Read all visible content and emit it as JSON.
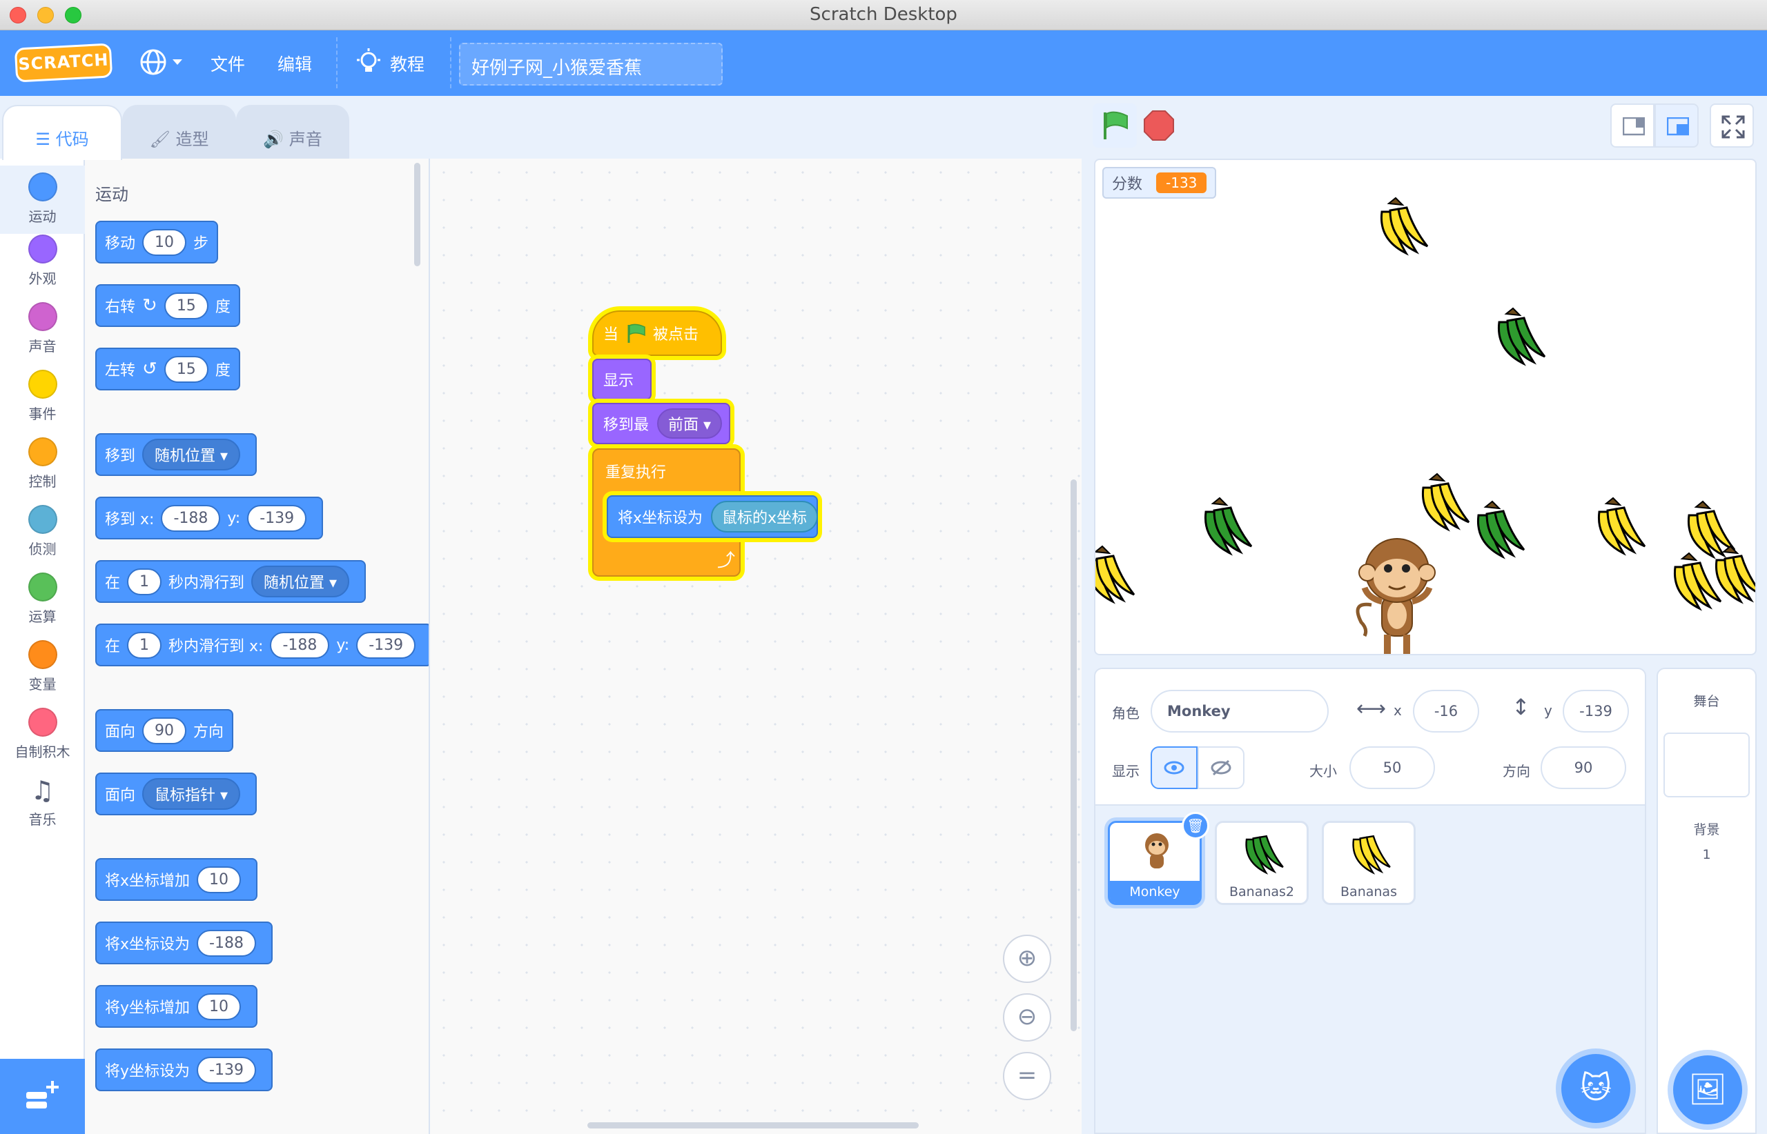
{
  "window": {
    "title": "Scratch Desktop"
  },
  "menubar": {
    "logo": "SCRATCH",
    "file": "文件",
    "edit": "编辑",
    "tutorials": "教程",
    "project_title": "好例子网_小猴爱香蕉"
  },
  "tabs": [
    {
      "label": "代码",
      "icon": "code-icon",
      "active": true
    },
    {
      "label": "造型",
      "icon": "brush-icon",
      "active": false
    },
    {
      "label": "声音",
      "icon": "speaker-icon",
      "active": false
    }
  ],
  "categories": [
    {
      "label": "运动",
      "color": "#4c97ff"
    },
    {
      "label": "外观",
      "color": "#9966ff"
    },
    {
      "label": "声音",
      "color": "#cf63cf"
    },
    {
      "label": "事件",
      "color": "#ffd500"
    },
    {
      "label": "控制",
      "color": "#ffab19"
    },
    {
      "label": "侦测",
      "color": "#5cb1d6"
    },
    {
      "label": "运算",
      "color": "#59c059"
    },
    {
      "label": "变量",
      "color": "#ff8c1a"
    },
    {
      "label": "自制积木",
      "color": "#ff6680"
    },
    {
      "label": "音乐",
      "color": "#0fbd8c"
    }
  ],
  "palette": {
    "heading": "运动",
    "blocks": {
      "move_a": "移动",
      "move_val": "10",
      "move_b": "步",
      "turn_right_a": "右转",
      "turn_right_val": "15",
      "turn_right_b": "度",
      "turn_left_a": "左转",
      "turn_left_val": "15",
      "turn_left_b": "度",
      "goto_a": "移到",
      "goto_drop": "随机位置",
      "gotoxy_a": "移到 x:",
      "gotoxy_x": "-188",
      "gotoxy_b": "y:",
      "gotoxy_y": "-139",
      "glide_a": "在",
      "glide_secs": "1",
      "glide_b": "秒内滑行到",
      "glide_drop": "随机位置",
      "glidexy_a": "在",
      "glidexy_secs": "1",
      "glidexy_b": "秒内滑行到 x:",
      "glidexy_x": "-188",
      "glidexy_c": "y:",
      "glidexy_y": "-139",
      "point_a": "面向",
      "point_val": "90",
      "point_b": "方向",
      "pointto_a": "面向",
      "pointto_drop": "鼠标指针",
      "changex_a": "将x坐标增加",
      "changex_val": "10",
      "setx_a": "将x坐标设为",
      "setx_val": "-188",
      "changey_a": "将y坐标增加",
      "changey_val": "10",
      "sety_a": "将y坐标设为",
      "sety_val": "-139"
    }
  },
  "script": {
    "hat_a": "当",
    "hat_b": "被点击",
    "show": "显示",
    "front_a": "移到最",
    "front_drop": "前面",
    "forever": "重复执行",
    "setx_a": "将x坐标设为",
    "setx_reporter": "鼠标的x坐标"
  },
  "stage": {
    "monitor_label": "分数",
    "monitor_value": "-133"
  },
  "sprite_info": {
    "sprite_label": "角色",
    "sprite_name": "Monkey",
    "x_label": "x",
    "x_value": "-16",
    "y_label": "y",
    "y_value": "-139",
    "show_label": "显示",
    "size_label": "大小",
    "size_value": "50",
    "direction_label": "方向",
    "direction_value": "90"
  },
  "sprites": [
    {
      "name": "Monkey",
      "selected": true
    },
    {
      "name": "Bananas2",
      "selected": false
    },
    {
      "name": "Bananas",
      "selected": false
    }
  ],
  "stage_panel": {
    "title": "舞台",
    "backdrop_label": "背景",
    "backdrop_count": "1"
  },
  "colors": {
    "menubar": "#4c97ff",
    "motion": "#4c97ff",
    "looks": "#9966ff",
    "control": "#ffab19",
    "events": "#ffbf00",
    "sensing": "#5cb1d6"
  }
}
